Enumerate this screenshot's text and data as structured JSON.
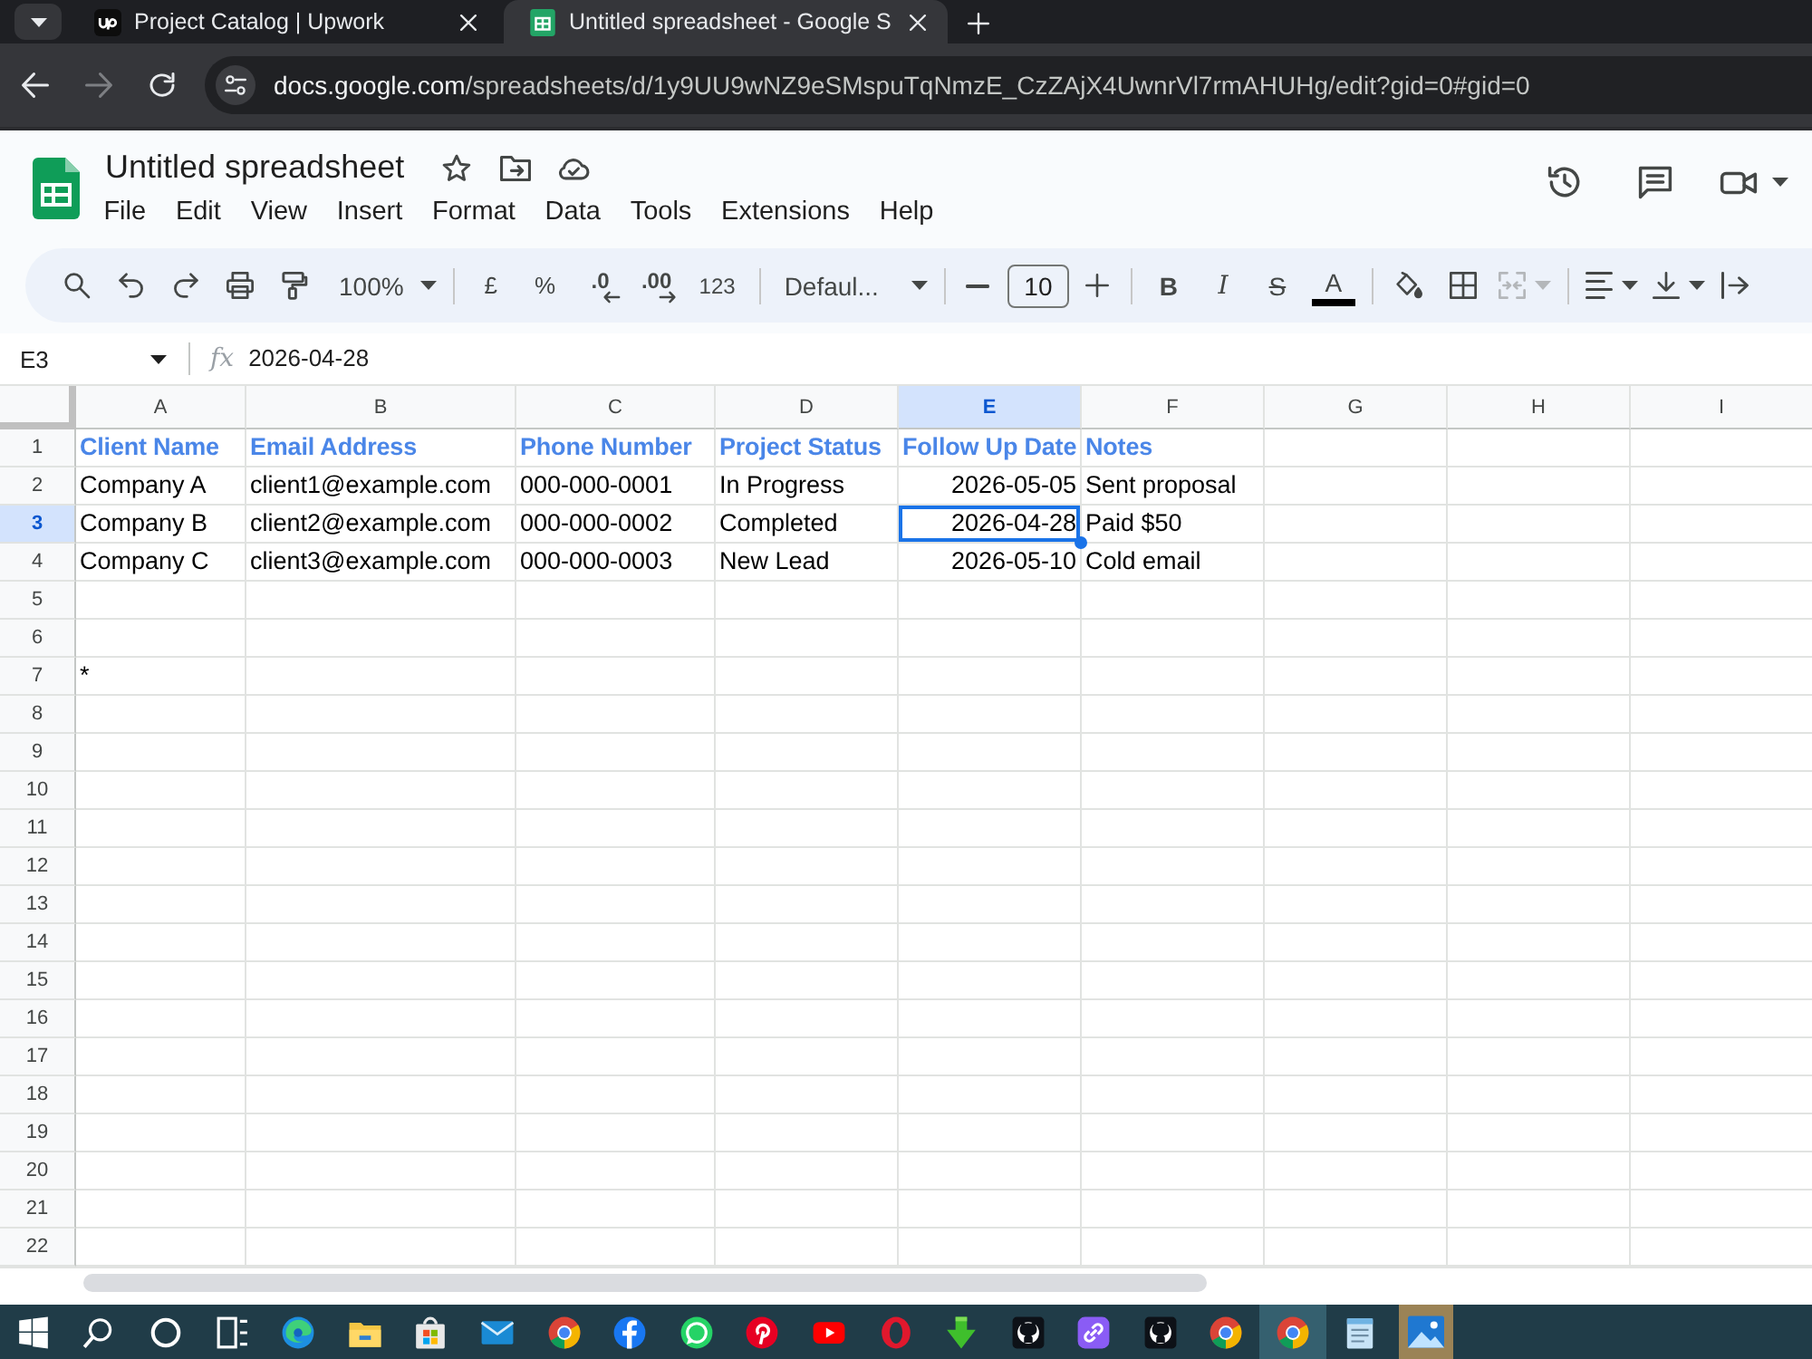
{
  "browser": {
    "tabs": [
      {
        "title": "Project Catalog | Upwork",
        "selected": false
      },
      {
        "title": "Untitled spreadsheet - Google S",
        "selected": true
      }
    ],
    "nav": [
      {
        "kind": "back",
        "disabled": false
      },
      {
        "kind": "forward",
        "disabled": true
      },
      {
        "kind": "reload",
        "disabled": false
      }
    ],
    "url": {
      "host": "docs.google.com",
      "path": "/spreadsheets/d/1y9UU9wNZ9eSMspuTqNmzE_CzZAjX4UwnrVl7rmAHUHg/edit?gid=0#gid=0"
    }
  },
  "app": {
    "title": "Untitled spreadsheet",
    "menu": [
      "File",
      "Edit",
      "View",
      "Insert",
      "Format",
      "Data",
      "Tools",
      "Extensions",
      "Help"
    ]
  },
  "toolbar": {
    "zoom": "100%",
    "currency": "£",
    "percent": "%",
    "decrease_decimals": ".0",
    "increase_decimals": ".00",
    "more_formats": "123",
    "font": "Defaul...",
    "font_size": "10",
    "bold": "B",
    "italic": "I",
    "strikethrough": "S",
    "text_color": "A",
    "merge_disabled": true
  },
  "formula_bar": {
    "name_box": "E3",
    "function_label": "fx",
    "value": "2026-04-28"
  },
  "sheet": {
    "columns": [
      {
        "label": "A",
        "selected": false
      },
      {
        "label": "B",
        "selected": false
      },
      {
        "label": "C",
        "selected": false
      },
      {
        "label": "D",
        "selected": false
      },
      {
        "label": "E",
        "selected": true
      },
      {
        "label": "F",
        "selected": false
      },
      {
        "label": "G",
        "selected": false
      },
      {
        "label": "H",
        "selected": false
      },
      {
        "label": "I",
        "selected": false
      }
    ],
    "rows": [
      {
        "number": "1",
        "kind": "header",
        "selected": false,
        "cells": [
          {
            "kind": "text",
            "text": "Client Name"
          },
          {
            "kind": "text",
            "text": "Email Address"
          },
          {
            "kind": "text",
            "text": "Phone Number"
          },
          {
            "kind": "text",
            "text": "Project Status"
          },
          {
            "kind": "text",
            "text": "Follow Up Date"
          },
          {
            "kind": "text",
            "text": "Notes"
          }
        ]
      },
      {
        "number": "2",
        "kind": "data",
        "selected": false,
        "cells": [
          {
            "kind": "text",
            "text": "Company A"
          },
          {
            "kind": "text",
            "text": "client1@example.com"
          },
          {
            "kind": "text",
            "text": "000-000-0001"
          },
          {
            "kind": "text",
            "text": "In Progress"
          },
          {
            "kind": "date",
            "text": "2026-05-05"
          },
          {
            "kind": "text",
            "text": "Sent proposal"
          }
        ]
      },
      {
        "number": "3",
        "kind": "data",
        "selected": true,
        "cells": [
          {
            "kind": "text",
            "text": "Company B"
          },
          {
            "kind": "text",
            "text": "client2@example.com"
          },
          {
            "kind": "text",
            "text": "000-000-0002"
          },
          {
            "kind": "text",
            "text": "Completed"
          },
          {
            "kind": "date",
            "text": "2026-04-28"
          },
          {
            "kind": "text",
            "text": "Paid $50"
          }
        ]
      },
      {
        "number": "4",
        "kind": "data",
        "selected": false,
        "cells": [
          {
            "kind": "text",
            "text": "Company C"
          },
          {
            "kind": "text",
            "text": "client3@example.com"
          },
          {
            "kind": "text",
            "text": "000-000-0003"
          },
          {
            "kind": "text",
            "text": "New Lead"
          },
          {
            "kind": "date",
            "text": "2026-05-10"
          },
          {
            "kind": "text",
            "text": "Cold email"
          }
        ]
      },
      {
        "number": "5",
        "kind": "data",
        "selected": false
      },
      {
        "number": "6",
        "kind": "data",
        "selected": false
      },
      {
        "number": "7",
        "kind": "data",
        "selected": false,
        "cells": [
          {
            "kind": "text",
            "text": "*"
          }
        ]
      },
      {
        "number": "8",
        "kind": "data",
        "selected": false
      },
      {
        "number": "9",
        "kind": "data",
        "selected": false
      },
      {
        "number": "10",
        "kind": "data",
        "selected": false
      },
      {
        "number": "11",
        "kind": "data",
        "selected": false
      },
      {
        "number": "12",
        "kind": "data",
        "selected": false
      },
      {
        "number": "13",
        "kind": "data",
        "selected": false
      },
      {
        "number": "14",
        "kind": "data",
        "selected": false
      },
      {
        "number": "15",
        "kind": "data",
        "selected": false
      },
      {
        "number": "16",
        "kind": "data",
        "selected": false
      },
      {
        "number": "17",
        "kind": "data",
        "selected": false
      },
      {
        "number": "18",
        "kind": "data",
        "selected": false
      },
      {
        "number": "19",
        "kind": "data",
        "selected": false
      },
      {
        "number": "20",
        "kind": "data",
        "selected": false
      },
      {
        "number": "21",
        "kind": "data",
        "selected": false
      },
      {
        "number": "22",
        "kind": "data",
        "selected": false
      }
    ]
  },
  "taskbar": {
    "items": [
      {
        "kind": "start",
        "selected": false
      },
      {
        "kind": "search",
        "selected": false
      },
      {
        "kind": "ring",
        "selected": false
      },
      {
        "kind": "taskview",
        "selected": false
      },
      {
        "kind": "edge",
        "selected": false
      },
      {
        "kind": "folder",
        "selected": false
      },
      {
        "kind": "store",
        "selected": false
      },
      {
        "kind": "mail",
        "selected": false
      },
      {
        "kind": "chrome",
        "selected": false
      },
      {
        "kind": "facebook",
        "selected": false
      },
      {
        "kind": "whatsapp",
        "selected": false
      },
      {
        "kind": "pinterest",
        "selected": false
      },
      {
        "kind": "youtube",
        "selected": false
      },
      {
        "kind": "opera",
        "selected": false
      },
      {
        "kind": "download",
        "selected": false
      },
      {
        "kind": "github",
        "selected": false
      },
      {
        "kind": "link",
        "selected": false
      },
      {
        "kind": "github",
        "selected": false
      },
      {
        "kind": "chrome",
        "selected": false
      },
      {
        "kind": "chrome",
        "selected": true
      },
      {
        "kind": "notepad",
        "selected": false
      },
      {
        "kind": "photos",
        "selected": false
      }
    ]
  }
}
